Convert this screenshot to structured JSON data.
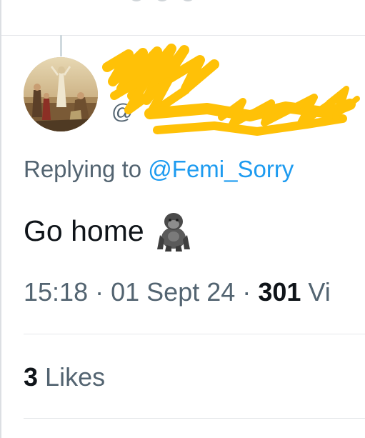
{
  "tweet": {
    "author": {
      "display_name": "",
      "handle_prefix": "@",
      "verified_color": "#1d9bf0"
    },
    "replying_label": "Replying to",
    "replying_to": "@Femi_Sorry",
    "text": "Go home",
    "emoji": "gorilla-icon",
    "time": "15:18",
    "date": "01 Sept 24",
    "views_count": "301",
    "views_label": "Vi",
    "likes_count": "3",
    "likes_label": "Likes"
  },
  "colors": {
    "text_primary": "#0f1419",
    "text_secondary": "#536471",
    "link": "#1d9bf0",
    "redaction": "#ffc107",
    "divider": "#e5e7ea"
  }
}
